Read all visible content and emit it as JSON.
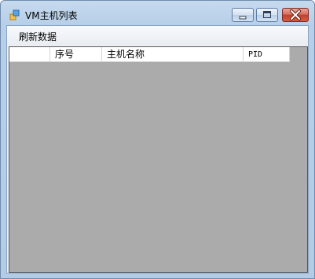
{
  "window": {
    "title": "VM主机列表",
    "minimize_icon": "minimize-icon",
    "maximize_icon": "maximize-icon",
    "close_icon": "close-icon"
  },
  "menubar": {
    "items": [
      {
        "label": "刷新数据"
      }
    ]
  },
  "grid": {
    "columns": [
      {
        "label": ""
      },
      {
        "label": "序号"
      },
      {
        "label": "主机名称"
      },
      {
        "label": "PID"
      }
    ],
    "rows": []
  },
  "colors": {
    "grid_background": "#ababab",
    "close_button": "#c0412b",
    "titlebar": "#b9d1ea"
  }
}
